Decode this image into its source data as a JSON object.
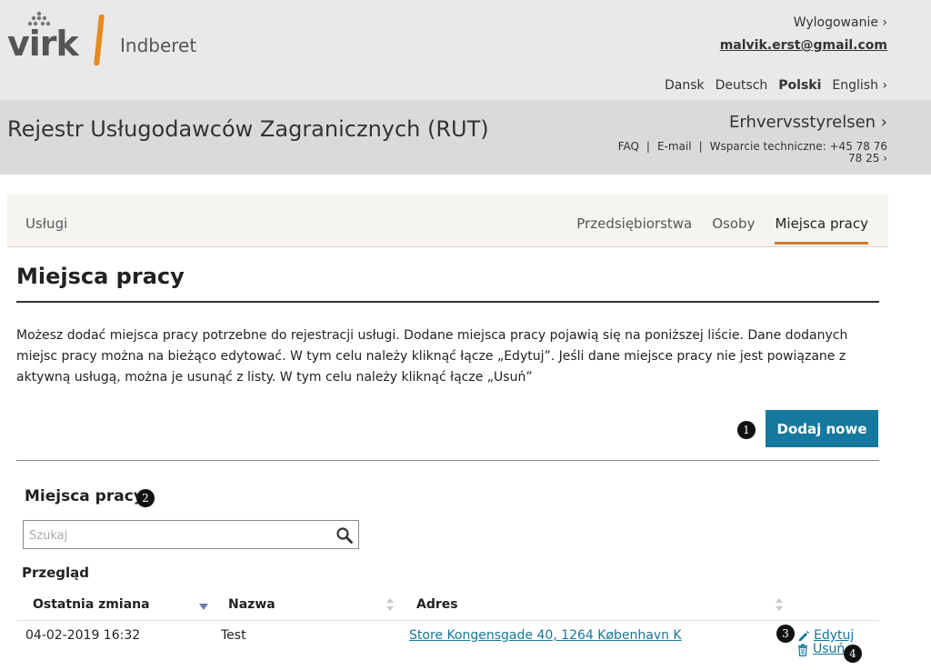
{
  "header": {
    "logo_text": "virk",
    "logo_sub": "Indberet",
    "logout_label": "Wylogowanie ›",
    "user_email": "malvik.erst@gmail.com",
    "languages": [
      "Dansk",
      "Deutsch",
      "Polski",
      "English ›"
    ],
    "active_language": "Polski",
    "app_title": "Rejestr Usługodawców Zagranicznych (RUT)",
    "agency_link": "Erhvervsstyrelsen ›",
    "faq_label": "FAQ",
    "email_label": "E-mail",
    "support_label": "Wsparcie techniczne: +45 78 76 78 25 ›"
  },
  "nav": {
    "left_tab": "Usługi",
    "tabs": [
      "Przedsiębiorstwa",
      "Osoby",
      "Miejsca pracy"
    ],
    "active_tab": "Miejsca pracy"
  },
  "page": {
    "title": "Miejsca pracy",
    "intro": "Możesz dodać miejsca pracy potrzebne do rejestracji usługi. Dodane miejsca pracy pojawią się na poniższej liście. Dane dodanych miejsc pracy można na bieżąco edytować. W tym celu należy kliknąć łącze „Edytuj”. Jeśli dane miejsce pracy nie jest powiązane z aktywną usługą, można je usunąć z listy. W tym celu należy kliknąć łącze „Usuń”",
    "add_button": "Dodaj nowe",
    "badges": [
      "1",
      "2",
      "3",
      "4"
    ]
  },
  "list": {
    "title": "Miejsca pracy",
    "search_placeholder": "Szukaj",
    "overview_label": "Przegląd",
    "columns": [
      "Ostatnia zmiana",
      "Nazwa",
      "Adres"
    ],
    "rows": [
      {
        "changed": "04-02-2019 16:32",
        "name": "Test",
        "address": "Store Kongensgade 40, 1264 København K",
        "edit_label": "Edytuj",
        "delete_label": "Usuń"
      }
    ]
  },
  "colors": {
    "accent": "#15789e",
    "tab_underline": "#d17a2a",
    "logo_bar": "#e58b1e"
  }
}
